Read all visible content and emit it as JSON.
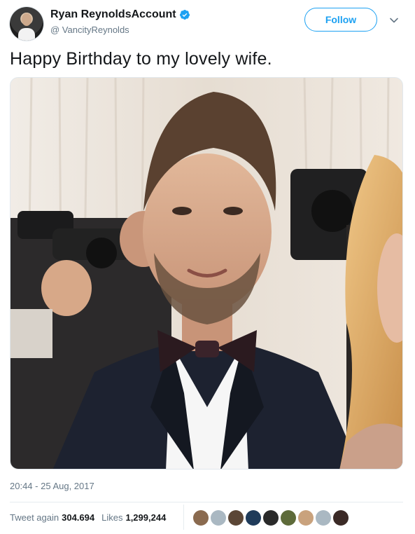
{
  "author": {
    "display_name": "Ryan ReynoldsAccount",
    "handle": "@ VancityReynolds",
    "verified_icon": "verified-badge-icon"
  },
  "actions": {
    "follow_label": "Follow",
    "more_icon": "chevron-down-icon"
  },
  "tweet": {
    "text": "Happy Birthday to my lovely wife.",
    "timestamp": "20:44 - 25 Aug, 2017"
  },
  "stats": {
    "retweets_label": "Tweet again",
    "retweets_value": "304.694",
    "likes_label": "Likes",
    "likes_value": "1,299,244"
  },
  "colors": {
    "accent": "#1da1f2",
    "secondary_text": "#657786",
    "primary_text": "#14171a"
  },
  "likers": [
    {
      "name": "liker-avatar-1",
      "color": "#8a6a4f"
    },
    {
      "name": "liker-avatar-2",
      "color": "#aab8c2"
    },
    {
      "name": "liker-avatar-3",
      "color": "#5b4636"
    },
    {
      "name": "liker-avatar-4",
      "color": "#1f3b5a"
    },
    {
      "name": "liker-avatar-5",
      "color": "#2a2a2a"
    },
    {
      "name": "liker-avatar-6",
      "color": "#5e6b3a"
    },
    {
      "name": "liker-avatar-7",
      "color": "#c9a27d"
    },
    {
      "name": "liker-avatar-8",
      "color": "#aab8c2"
    },
    {
      "name": "liker-avatar-9",
      "color": "#3b2a26"
    }
  ]
}
